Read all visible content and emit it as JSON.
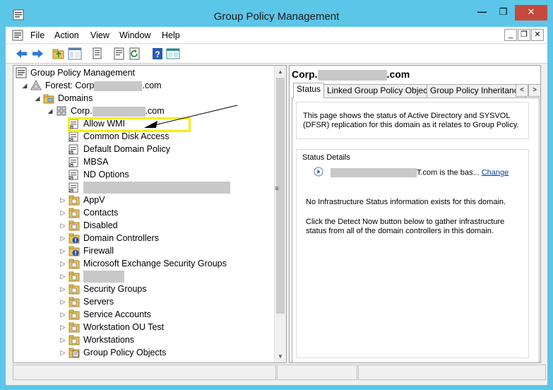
{
  "window": {
    "title": "Group Policy Management",
    "controls": {
      "minimize": "—",
      "maximize": "❐",
      "close": "✕"
    }
  },
  "menu": {
    "items": [
      "File",
      "Action",
      "View",
      "Window",
      "Help"
    ],
    "mdi": {
      "minimize": "_",
      "restore": "❐",
      "close": "✕"
    }
  },
  "toolbar": {
    "icons": [
      "back-icon",
      "forward-icon",
      "up-folder-icon",
      "show-hide-tree-icon",
      "copy-icon",
      "properties-icon",
      "refresh-icon",
      "help-icon",
      "console-icon"
    ]
  },
  "tree": {
    "root": "Group Policy Management",
    "forest_prefix": "Forest: Corp",
    "forest_suffix": ".com",
    "domains": "Domains",
    "domain_prefix": "Corp.",
    "domain_suffix": ".com",
    "items": [
      {
        "label": "Allow WMI",
        "type": "gpo-link"
      },
      {
        "label": "Common Disk Access",
        "type": "gpo-link"
      },
      {
        "label": "Default Domain Policy",
        "type": "gpo-link"
      },
      {
        "label": "MBSA",
        "type": "gpo-link"
      },
      {
        "label": "ND Options",
        "type": "gpo-link"
      },
      {
        "label": "",
        "type": "gpo-link-redacted"
      },
      {
        "label": "AppV",
        "type": "ou"
      },
      {
        "label": "Contacts",
        "type": "ou"
      },
      {
        "label": "Disabled",
        "type": "ou"
      },
      {
        "label": "Domain Controllers",
        "type": "ou-warning"
      },
      {
        "label": "Firewall",
        "type": "ou-warning"
      },
      {
        "label": "Microsoft Exchange Security Groups",
        "type": "ou"
      },
      {
        "label": "",
        "type": "ou-redacted"
      },
      {
        "label": "Security Groups",
        "type": "ou"
      },
      {
        "label": "Servers",
        "type": "ou"
      },
      {
        "label": "Service Accounts",
        "type": "ou"
      },
      {
        "label": "Workstation OU Test",
        "type": "ou"
      },
      {
        "label": "Workstations",
        "type": "ou"
      },
      {
        "label": "Group Policy Objects",
        "type": "gpo-container"
      }
    ]
  },
  "details": {
    "title_prefix": "Corp.",
    "title_suffix": ".com",
    "tabs": [
      "Status",
      "Linked Group Policy Objects",
      "Group Policy Inheritance"
    ],
    "active_tab": "Status",
    "tab_scroll": {
      "left": "<",
      "right": ">"
    },
    "description": "This page shows the status of Active Directory and SYSVOL (DFSR) replication for this domain as it relates to Group Policy.",
    "status_details_label": "Status Details",
    "baseline_suffix": "T.com is the bas...",
    "change_link": "Change",
    "no_info": "No Infrastructure Status information exists for this domain.",
    "detect_hint": "Click the Detect Now button below to gather infrastructure status from all of the domain controllers in this domain."
  },
  "colors": {
    "titlebar": "#5cc6e8",
    "close_button": "#c7483d",
    "highlight_box": "#f5f000",
    "link": "#0645ad"
  }
}
